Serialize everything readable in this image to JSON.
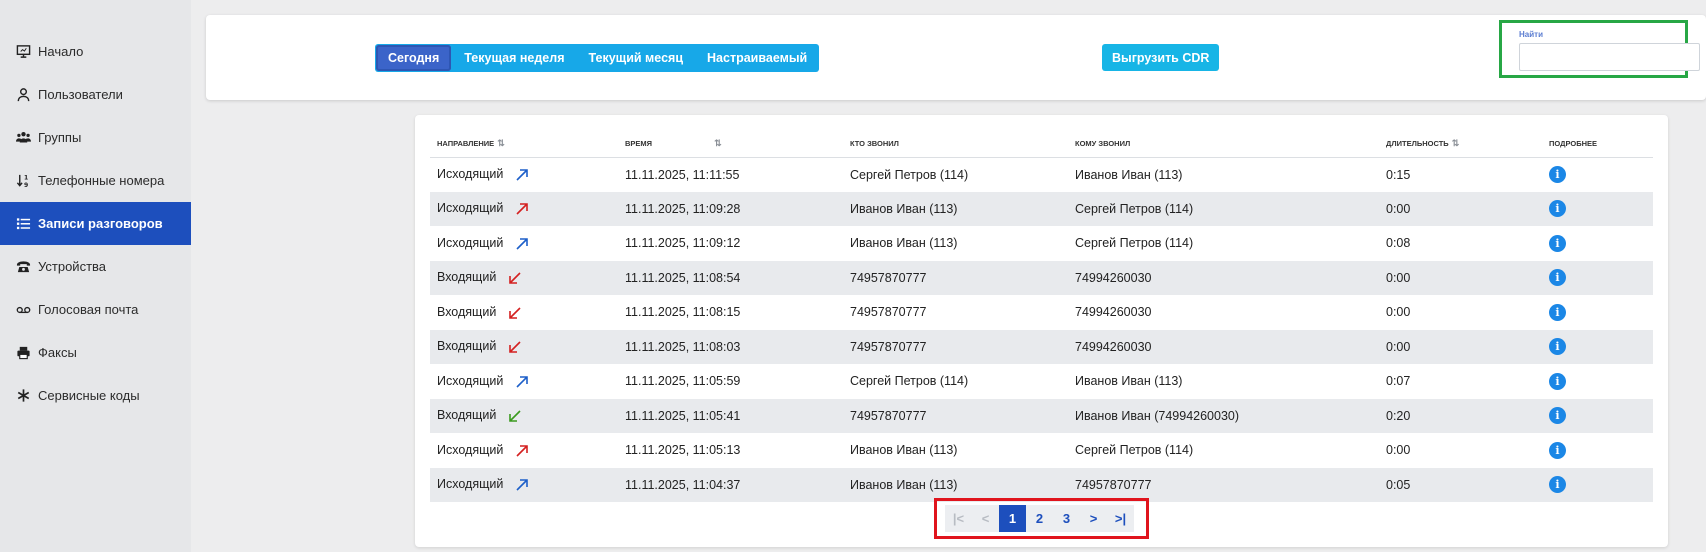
{
  "sidebar": {
    "items": [
      {
        "label": "Начало",
        "icon": "monitor-icon"
      },
      {
        "label": "Пользователи",
        "icon": "user-icon"
      },
      {
        "label": "Группы",
        "icon": "users-icon"
      },
      {
        "label": "Телефонные номера",
        "icon": "sort-numbers-icon"
      },
      {
        "label": "Записи разговоров",
        "icon": "list-icon"
      },
      {
        "label": "Устройства",
        "icon": "phone-icon"
      },
      {
        "label": "Голосовая почта",
        "icon": "voicemail-icon"
      },
      {
        "label": "Факсы",
        "icon": "printer-icon"
      },
      {
        "label": "Сервисные коды",
        "icon": "asterisk-icon"
      }
    ],
    "active_index": 4
  },
  "filters": {
    "today": "Сегодня",
    "week": "Текущая неделя",
    "month": "Текущий месяц",
    "custom": "Настраиваемый"
  },
  "export_label": "Выгрузить CDR",
  "search": {
    "label": "Найти",
    "value": ""
  },
  "table": {
    "headers": {
      "direction": "Направление",
      "time": "Время",
      "caller": "Кто звонил",
      "callee": "Кому звонил",
      "duration": "Длительность",
      "details": "Подробнее"
    },
    "rows": [
      {
        "direction": "Исходящий",
        "arrow": "outgoing-blue",
        "time": "11.11.2025, 11:11:55",
        "caller": "Сергей Петров (114)",
        "callee": "Иванов Иван (113)",
        "duration": "0:15"
      },
      {
        "direction": "Исходящий",
        "arrow": "outgoing-red",
        "time": "11.11.2025, 11:09:28",
        "caller": "Иванов Иван (113)",
        "callee": "Сергей Петров (114)",
        "duration": "0:00"
      },
      {
        "direction": "Исходящий",
        "arrow": "outgoing-blue",
        "time": "11.11.2025, 11:09:12",
        "caller": "Иванов Иван (113)",
        "callee": "Сергей Петров (114)",
        "duration": "0:08"
      },
      {
        "direction": "Входящий",
        "arrow": "incoming-red",
        "time": "11.11.2025, 11:08:54",
        "caller": "74957870777",
        "callee": "74994260030",
        "duration": "0:00"
      },
      {
        "direction": "Входящий",
        "arrow": "incoming-red",
        "time": "11.11.2025, 11:08:15",
        "caller": "74957870777",
        "callee": "74994260030",
        "duration": "0:00"
      },
      {
        "direction": "Входящий",
        "arrow": "incoming-red",
        "time": "11.11.2025, 11:08:03",
        "caller": "74957870777",
        "callee": "74994260030",
        "duration": "0:00"
      },
      {
        "direction": "Исходящий",
        "arrow": "outgoing-blue",
        "time": "11.11.2025, 11:05:59",
        "caller": "Сергей Петров (114)",
        "callee": "Иванов Иван (113)",
        "duration": "0:07"
      },
      {
        "direction": "Входящий",
        "arrow": "incoming-green",
        "time": "11.11.2025, 11:05:41",
        "caller": "74957870777",
        "callee": "Иванов Иван (74994260030)",
        "duration": "0:20"
      },
      {
        "direction": "Исходящий",
        "arrow": "outgoing-red",
        "time": "11.11.2025, 11:05:13",
        "caller": "Иванов Иван (113)",
        "callee": "Сергей Петров (114)",
        "duration": "0:00"
      },
      {
        "direction": "Исходящий",
        "arrow": "outgoing-blue",
        "time": "11.11.2025, 11:04:37",
        "caller": "Иванов Иван (113)",
        "callee": "74957870777",
        "duration": "0:05"
      }
    ]
  },
  "pagination": {
    "first": "|<",
    "prev": "<",
    "pages": [
      "1",
      "2",
      "3"
    ],
    "current": "1",
    "next": ">",
    "last": ">|"
  },
  "colors": {
    "accent": "#1d4fbd",
    "button": "#17a8e8",
    "arrow_blue": "#1d5fc9",
    "arrow_red": "#d42020",
    "arrow_green": "#3a9a1e",
    "highlight_green": "#27a745",
    "highlight_red": "#e0141d"
  }
}
